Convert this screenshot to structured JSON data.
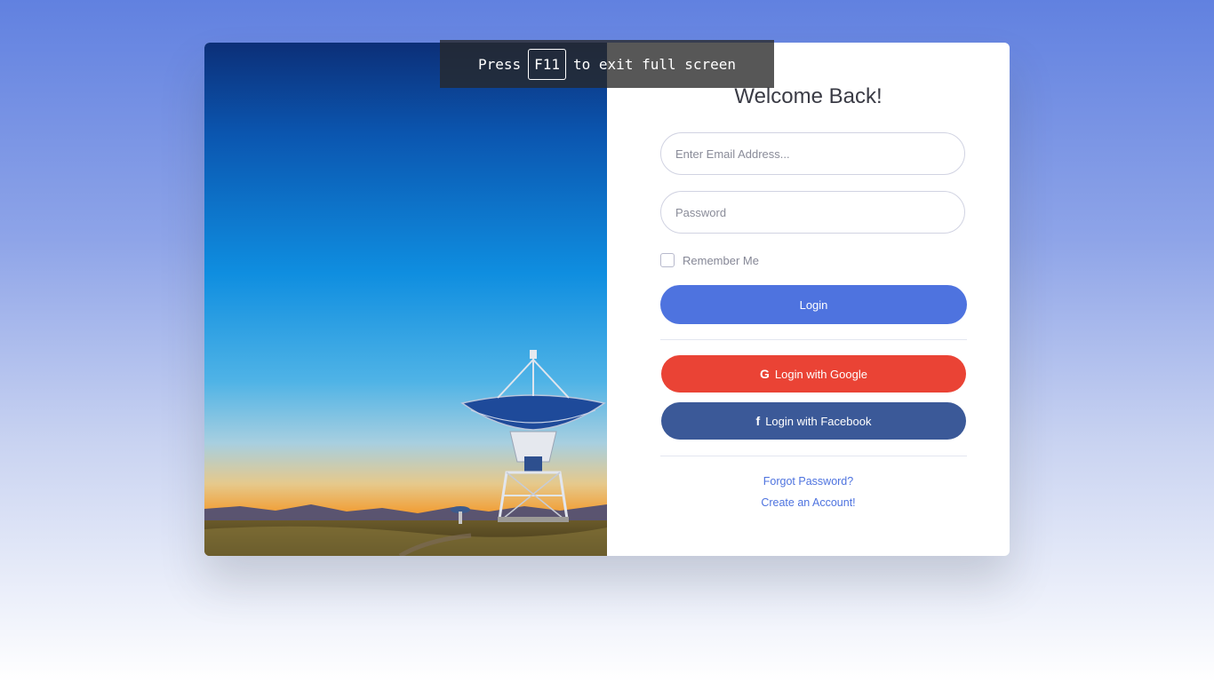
{
  "overlay": {
    "prefix": "Press",
    "key": "F11",
    "suffix": "to exit full screen"
  },
  "form": {
    "title": "Welcome Back!",
    "email_placeholder": "Enter Email Address...",
    "password_placeholder": "Password",
    "remember_label": "Remember Me",
    "login_label": "Login",
    "google_label": "Login with Google",
    "facebook_label": "Login with Facebook",
    "forgot_label": "Forgot Password?",
    "create_label": "Create an Account!"
  },
  "icons": {
    "google": "G",
    "facebook": "f"
  },
  "colors": {
    "primary": "#4e73df",
    "google": "#ea4335",
    "facebook": "#3b5998"
  }
}
